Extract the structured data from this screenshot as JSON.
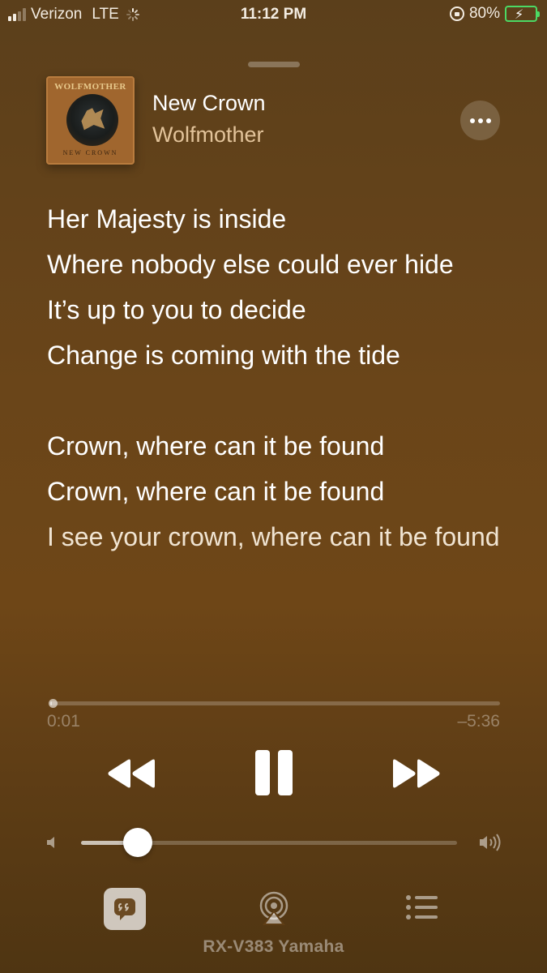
{
  "status_bar": {
    "carrier": "Verizon",
    "network": "LTE",
    "time": "11:12 PM",
    "battery": "80%",
    "battery_level": 0.8,
    "signal_bars": 2,
    "signal_total": 4
  },
  "now_playing": {
    "title": "New Crown",
    "artist": "Wolfmother",
    "album_art": {
      "band_text": "WOLFMOTHER",
      "album_text": "NEW CROWN"
    },
    "more_icon": "ellipsis-icon"
  },
  "lyrics": {
    "verse1": [
      "Her Majesty is inside",
      "Where nobody else could ever hide",
      "It’s up to you to decide",
      "Change is coming with the tide"
    ],
    "verse2": [
      "Crown, where can it be found",
      "Crown, where can it be found"
    ],
    "current_line": "I see your crown, where can it be found"
  },
  "playback": {
    "elapsed": "0:01",
    "remaining": "–5:36",
    "progress_fraction": 0.003,
    "state": "playing"
  },
  "volume": {
    "level_fraction": 0.15
  },
  "bottom_bar": {
    "lyrics_icon": "quote-bubble-icon",
    "airplay_icon": "airplay-icon",
    "queue_icon": "list-icon",
    "device": "RX-V383 Yamaha"
  },
  "colors": {
    "accent_artist": "#e2c39a",
    "battery_green": "#4cd964",
    "background": "#6a4519"
  }
}
